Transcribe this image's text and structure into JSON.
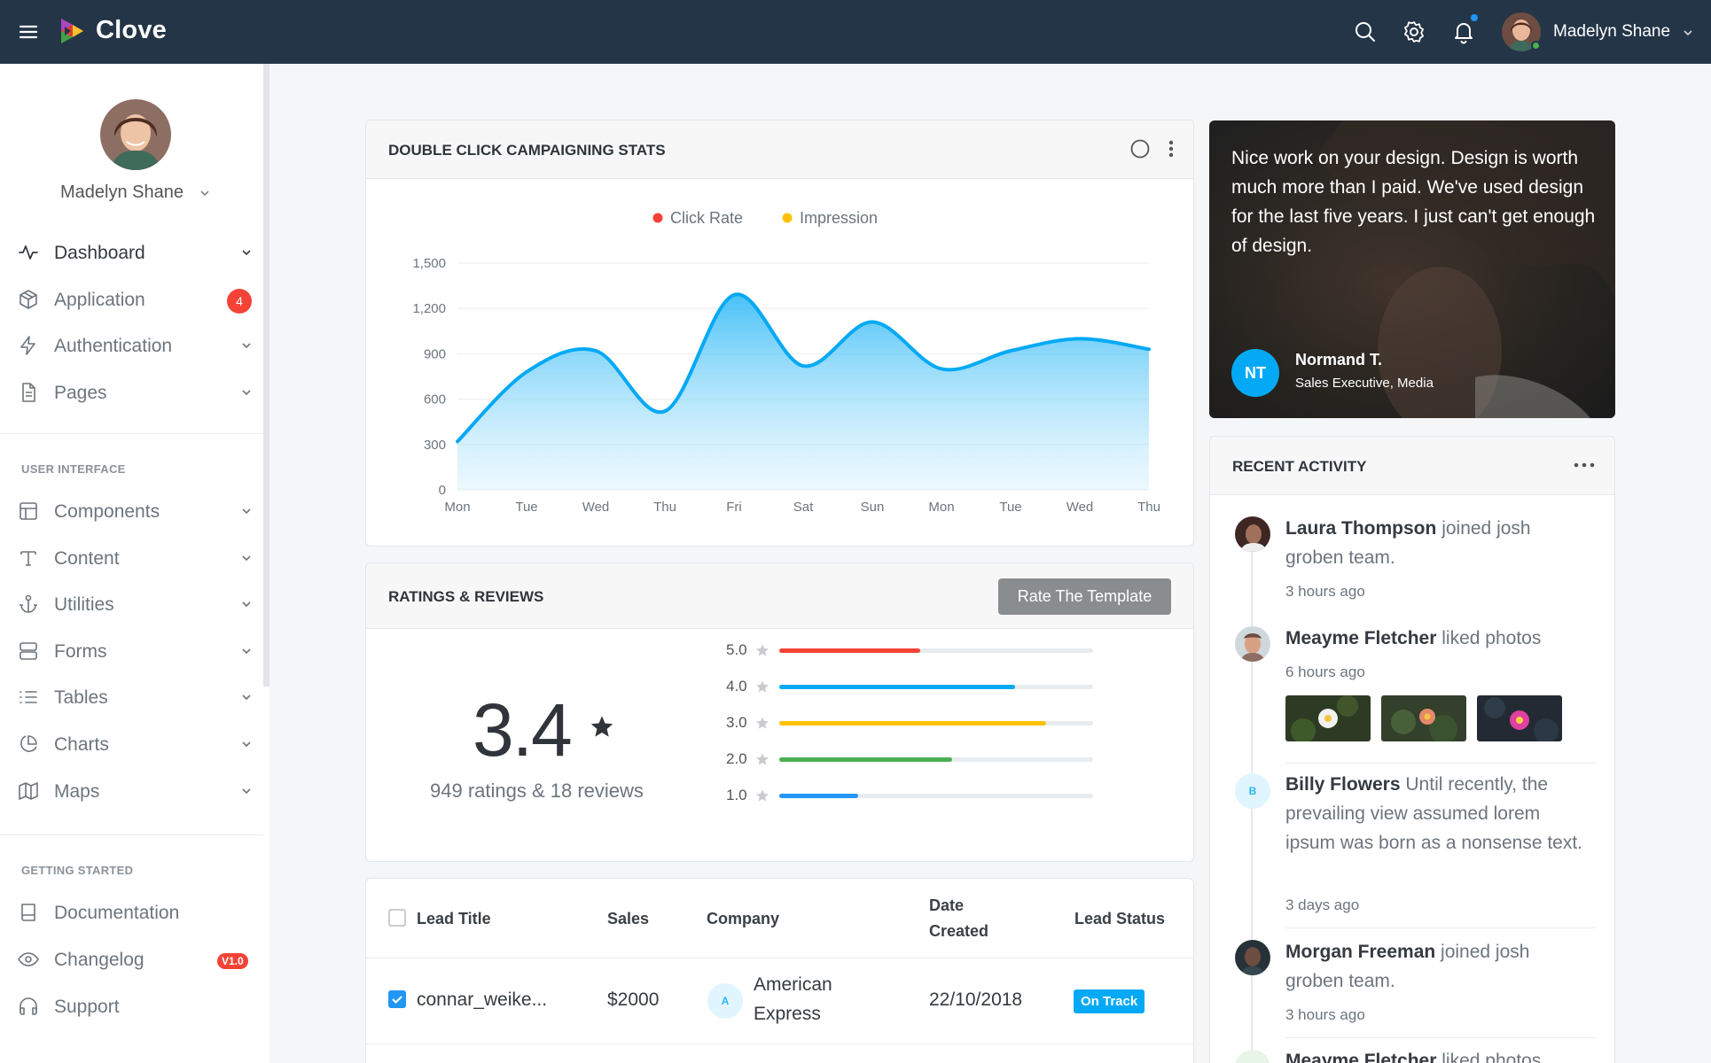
{
  "app": {
    "name": "Clove"
  },
  "topbar": {
    "user_name": "Madelyn Shane",
    "icons": [
      "menu-icon",
      "search-icon",
      "gear-icon",
      "bell-icon"
    ]
  },
  "sidebar": {
    "user_name": "Madelyn Shane",
    "main_items": [
      {
        "label": "Dashboard",
        "icon": "activity-icon",
        "active": true
      },
      {
        "label": "Application",
        "icon": "package-icon",
        "badge": "4"
      },
      {
        "label": "Authentication",
        "icon": "zap-icon"
      },
      {
        "label": "Pages",
        "icon": "file-icon"
      }
    ],
    "section_ui": "USER INTERFACE",
    "ui_items": [
      {
        "label": "Components",
        "icon": "layout-icon"
      },
      {
        "label": "Content",
        "icon": "type-icon"
      },
      {
        "label": "Utilities",
        "icon": "anchor-icon"
      },
      {
        "label": "Forms",
        "icon": "server-icon"
      },
      {
        "label": "Tables",
        "icon": "list-icon"
      },
      {
        "label": "Charts",
        "icon": "pie-chart-icon"
      },
      {
        "label": "Maps",
        "icon": "map-icon"
      }
    ],
    "section_start": "GETTING STARTED",
    "start_items": [
      {
        "label": "Documentation",
        "icon": "book-icon"
      },
      {
        "label": "Changelog",
        "icon": "eye-icon",
        "tag": "V1.0"
      },
      {
        "label": "Support",
        "icon": "headphones-icon"
      }
    ]
  },
  "chart_card": {
    "title": "DOUBLE CLICK CAMPAIGNING STATS"
  },
  "chart_data": {
    "type": "area",
    "title": "",
    "legend": [
      {
        "name": "Click Rate",
        "color": "#f44336"
      },
      {
        "name": "Impression",
        "color": "#ffc107"
      }
    ],
    "legend_position": "top-center",
    "categories": [
      "Mon",
      "Tue",
      "Wed",
      "Thu",
      "Fri",
      "Sat",
      "Sun",
      "Mon",
      "Tue",
      "Wed",
      "Thu"
    ],
    "yticks": [
      "0",
      "300",
      "600",
      "900",
      "1,200",
      "1,500"
    ],
    "ylim": [
      0,
      1500
    ],
    "grid": true,
    "series": [
      {
        "values": [
          320,
          780,
          920,
          520,
          1290,
          820,
          1110,
          800,
          920,
          1000,
          930
        ],
        "color": "#03a9f4"
      }
    ]
  },
  "testimonial": {
    "quote": "Nice work on your design. Design is worth much more than I paid. We've used design for the last five years. I just can't get enough of design.",
    "initials": "NT",
    "author": "Normand T.",
    "role": "Sales Executive, Media"
  },
  "ratings": {
    "title": "RATINGS & REVIEWS",
    "button": "Rate The Template",
    "score": "3.4",
    "summary": "949 ratings & 18 reviews",
    "rows": [
      {
        "label": "5.0",
        "fraction": 0.45,
        "color": "#f44336"
      },
      {
        "label": "4.0",
        "fraction": 0.75,
        "color": "#03a9f4"
      },
      {
        "label": "3.0",
        "fraction": 0.85,
        "color": "#ffc107"
      },
      {
        "label": "2.0",
        "fraction": 0.55,
        "color": "#4caf50"
      },
      {
        "label": "1.0",
        "fraction": 0.25,
        "color": "#2196f3"
      }
    ]
  },
  "table": {
    "headers": {
      "lead": "Lead Title",
      "sales": "Sales",
      "company": "Company",
      "date_1": "Date",
      "date_2": "Created",
      "status": "Lead Status"
    },
    "rows": [
      {
        "lead": "connar_weike...",
        "sales": "$2000",
        "company_initial": "A",
        "company_1": "American",
        "company_2": "Express",
        "date": "22/10/2018",
        "status": "On Track"
      }
    ]
  },
  "activity": {
    "title": "RECENT ACTIVITY",
    "items": [
      {
        "name": "Laura Thompson",
        "text": "joined josh groben team.",
        "time": "3 hours ago"
      },
      {
        "name": "Meayme Fletcher",
        "text": "liked photos",
        "time": "6 hours ago"
      },
      {
        "initial": "B",
        "name": "Billy Flowers",
        "text": "Until recently, the prevailing view assumed lorem ipsum was born as a nonsense text.",
        "time": "3 days ago"
      },
      {
        "name": "Morgan Freeman",
        "text": "joined josh groben team.",
        "time": "3 hours ago"
      },
      {
        "name": "Meayme Fletcher",
        "text": "liked photos"
      }
    ]
  }
}
